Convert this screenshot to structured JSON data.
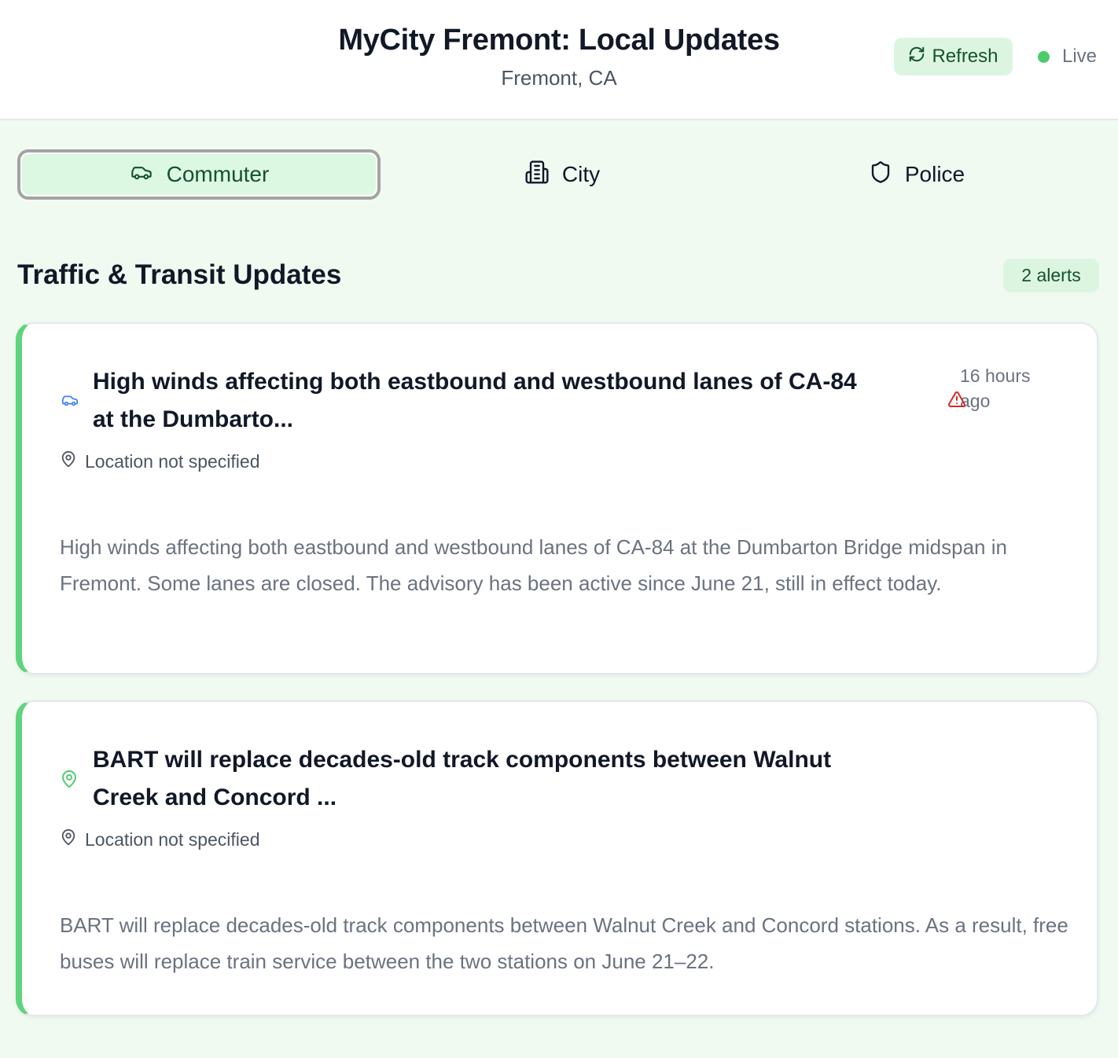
{
  "header": {
    "title": "MyCity Fremont: Local Updates",
    "subtitle": "Fremont, CA",
    "refresh_label": "Refresh",
    "live_label": "Live"
  },
  "tabs": [
    {
      "label": "Commuter",
      "icon": "car-icon",
      "active": true
    },
    {
      "label": "City",
      "icon": "building-icon",
      "active": false
    },
    {
      "label": "Police",
      "icon": "shield-icon",
      "active": false
    }
  ],
  "section": {
    "title": "Traffic & Transit Updates",
    "count_label": "2 alerts"
  },
  "alerts": [
    {
      "icon": "car-icon",
      "title_line1": "High winds affecting both eastbound and westbound lanes of CA-84",
      "title_line2": "at the Dumbarto...",
      "time_line1": "16 hours",
      "time_line2": "ago",
      "warning_icon": "alert-triangle-icon",
      "location": "Location not specified",
      "body": "High winds affecting both eastbound and westbound lanes of CA-84 at the Dumbarton Bridge midspan in Fremont. Some lanes are closed. The advisory has been active since June 21, still in effect today."
    },
    {
      "icon": "map-pin-icon",
      "title_line1": "BART will replace decades-old track components between Walnut",
      "title_line2": "Creek and Concord ...",
      "location": "Location not specified",
      "body": "BART will replace decades-old track components between Walnut Creek and Concord stations. As a result, free buses will replace train service between the two stations on June 21–22."
    }
  ],
  "colors": {
    "accent_green": "#5fd47c",
    "background": "#f0faf1",
    "live_dot": "#4ccb6b",
    "warning_red": "#dc2626",
    "car_icon_blue": "#3b82f6"
  }
}
